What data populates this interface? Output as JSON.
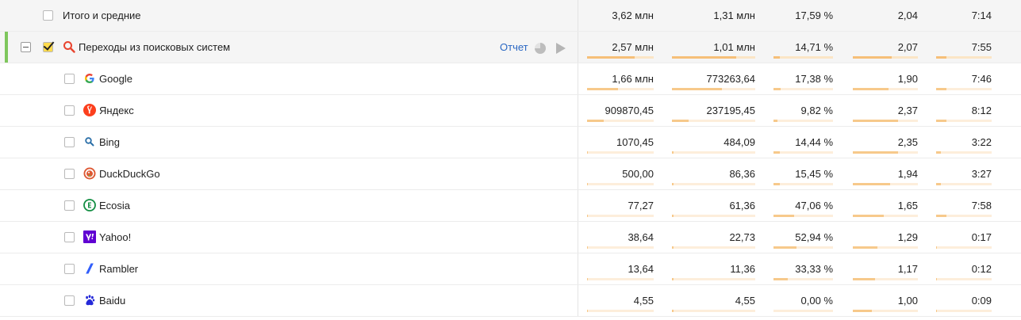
{
  "colors": {
    "group_accent": "#7ec65c",
    "bar_fill": "#f7c98b",
    "bar_track": "#fdeedb",
    "link": "#2b68c3"
  },
  "total_row": {
    "label": "Итого и средние",
    "values": [
      "3,62 млн",
      "1,31 млн",
      "17,59 %",
      "2,04",
      "7:14"
    ]
  },
  "group_row": {
    "label": "Переходы из поисковых систем",
    "report_label": "Отчет",
    "checked": true,
    "icon": "search-icon",
    "values": [
      "2,57 млн",
      "1,01 млн",
      "14,71 %",
      "2,07",
      "7:55"
    ],
    "bar_fractions": [
      0.71,
      0.77,
      0.1,
      0.6,
      0.18
    ]
  },
  "rows": [
    {
      "label": "Google",
      "icon": "google-icon",
      "values": [
        "1,66 млн",
        "773263,64",
        "17,38 %",
        "1,90",
        "7:46"
      ],
      "bar_fractions": [
        0.47,
        0.6,
        0.12,
        0.55,
        0.18
      ]
    },
    {
      "label": "Яндекс",
      "icon": "yandex-icon",
      "values": [
        "909870,45",
        "237195,45",
        "9,82 %",
        "2,37",
        "8:12"
      ],
      "bar_fractions": [
        0.25,
        0.2,
        0.07,
        0.7,
        0.19
      ]
    },
    {
      "label": "Bing",
      "icon": "bing-search-icon",
      "values": [
        "1070,45",
        "484,09",
        "14,44 %",
        "2,35",
        "3:22"
      ],
      "bar_fractions": [
        0.01,
        0.01,
        0.1,
        0.69,
        0.08
      ]
    },
    {
      "label": "DuckDuckGo",
      "icon": "duckduckgo-icon",
      "values": [
        "500,00",
        "86,36",
        "15,45 %",
        "1,94",
        "3:27"
      ],
      "bar_fractions": [
        0.005,
        0.005,
        0.11,
        0.57,
        0.08
      ]
    },
    {
      "label": "Ecosia",
      "icon": "ecosia-icon",
      "values": [
        "77,27",
        "61,36",
        "47,06 %",
        "1,65",
        "7:58"
      ],
      "bar_fractions": [
        0.003,
        0.003,
        0.34,
        0.48,
        0.18
      ]
    },
    {
      "label": "Yahoo!",
      "icon": "yahoo-icon",
      "values": [
        "38,64",
        "22,73",
        "52,94 %",
        "1,29",
        "0:17"
      ],
      "bar_fractions": [
        0.002,
        0.002,
        0.38,
        0.38,
        0.01
      ]
    },
    {
      "label": "Rambler",
      "icon": "rambler-icon",
      "values": [
        "13,64",
        "11,36",
        "33,33 %",
        "1,17",
        "0:12"
      ],
      "bar_fractions": [
        0.001,
        0.001,
        0.24,
        0.34,
        0.01
      ]
    },
    {
      "label": "Baidu",
      "icon": "baidu-icon",
      "values": [
        "4,55",
        "4,55",
        "0,00 %",
        "1,00",
        "0:09"
      ],
      "bar_fractions": [
        0.001,
        0.001,
        0,
        0.29,
        0.01
      ]
    }
  ]
}
